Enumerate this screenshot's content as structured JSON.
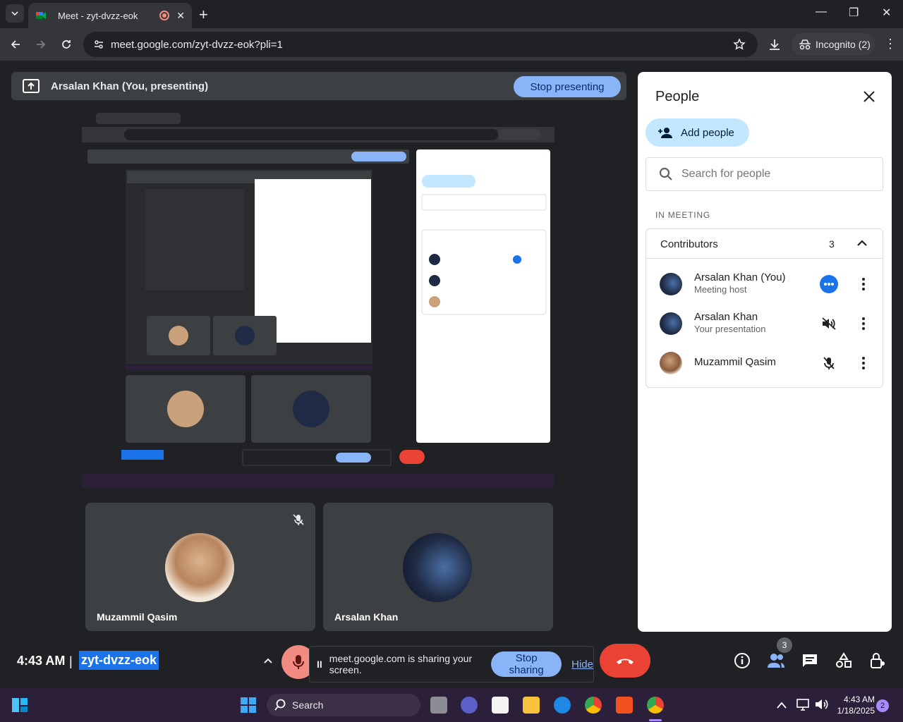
{
  "browser": {
    "tab_title": "Meet - zyt-dvzz-eok",
    "url": "meet.google.com/zyt-dvzz-eok?pli=1",
    "profile": "Incognito (2)"
  },
  "meet": {
    "presenting_label": "Arsalan Khan (You, presenting)",
    "stop_presenting": "Stop presenting",
    "tiles": [
      {
        "name": "Muzammil Qasim"
      },
      {
        "name": "Arsalan Khan"
      }
    ],
    "time": "4:43 AM",
    "separator": "|",
    "meeting_code": "zyt-dvzz-eok",
    "share_toast": {
      "text": "meet.google.com is sharing your screen.",
      "stop": "Stop sharing",
      "hide": "Hide"
    },
    "people_count": "3"
  },
  "people_panel": {
    "title": "People",
    "add_people": "Add people",
    "search_placeholder": "Search for people",
    "section": "IN MEETING",
    "group_label": "Contributors",
    "group_count": "3",
    "members": [
      {
        "name": "Arsalan Khan (You)",
        "role": "Meeting host"
      },
      {
        "name": "Arsalan Khan",
        "role": "Your presentation"
      },
      {
        "name": "Muzammil Qasim",
        "role": ""
      }
    ]
  },
  "taskbar": {
    "search": "Search",
    "time": "4:43 AM",
    "date": "1/18/2025",
    "notifications": "2"
  },
  "colors": {
    "accent": "#8ab4f8",
    "end_call": "#ea4335",
    "code_highlight": "#1a73e8"
  }
}
